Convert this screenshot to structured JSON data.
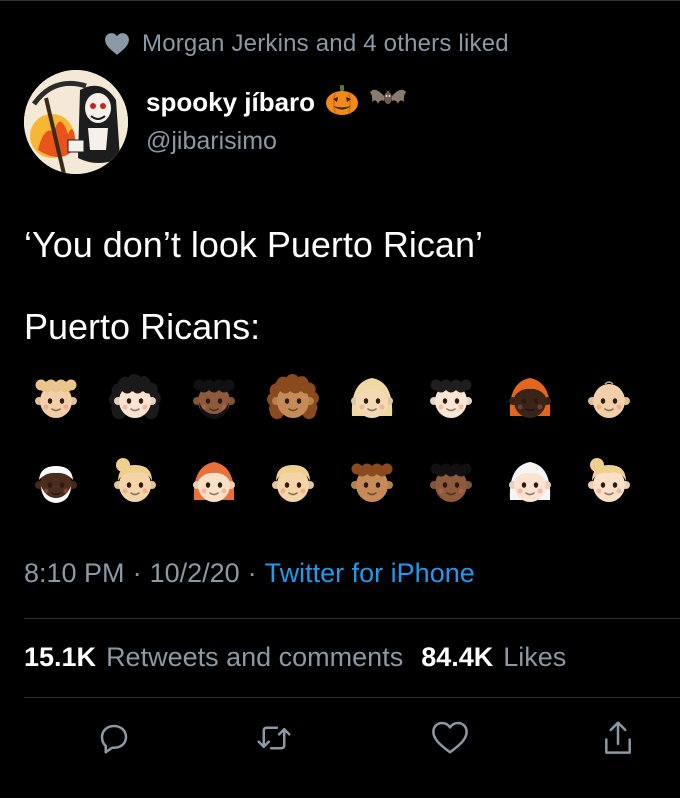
{
  "social_context": {
    "text": "Morgan Jerkins and 4 others liked",
    "icon": "heart-icon"
  },
  "author": {
    "display_name": "spooky jíbaro",
    "handle": "@jibarisimo",
    "name_emojis": [
      "jack-o-lantern-icon",
      "bat-icon"
    ]
  },
  "tweet": {
    "line1": "‘You don’t look Puerto Rican’",
    "line2": "Puerto Ricans:",
    "emojis": [
      {
        "name": "curly-hair-light-face-emoji",
        "skin": "#f2cfa8",
        "hair": "#e8c58a",
        "style": "curly"
      },
      {
        "name": "curly-hair-woman-light-face-emoji",
        "skin": "#fbe3cf",
        "hair": "#1a1a1a",
        "style": "long-curly"
      },
      {
        "name": "curly-hair-man-medium-dark-face-emoji",
        "skin": "#8d5a3b",
        "hair": "#111111",
        "style": "curly-beard"
      },
      {
        "name": "curly-hair-woman-medium-face-emoji",
        "skin": "#c68c57",
        "hair": "#8a4a1e",
        "style": "long-curly"
      },
      {
        "name": "blond-woman-face-emoji",
        "skin": "#f4d9b5",
        "hair": "#f1d7a0",
        "style": "long-straight"
      },
      {
        "name": "curly-hair-light-face-emoji-2",
        "skin": "#fbe6d6",
        "hair": "#1e1e1e",
        "style": "curly"
      },
      {
        "name": "dark-woman-red-hair-emoji",
        "skin": "#3a2418",
        "hair": "#e2661f",
        "style": "long-straight"
      },
      {
        "name": "baby-face-emoji",
        "skin": "#f2cfa8",
        "hair": "#f2cfa8",
        "style": "bald"
      },
      {
        "name": "old-man-dark-face-emoji",
        "skin": "#4a2d1c",
        "hair": "#ffffff",
        "style": "white-hair-beard"
      },
      {
        "name": "blond-ponytail-face-emoji",
        "skin": "#f4d4a8",
        "hair": "#efcf8e",
        "style": "ponytail"
      },
      {
        "name": "red-hair-woman-face-emoji",
        "skin": "#fbe0c8",
        "hair": "#e8703a",
        "style": "long-straight"
      },
      {
        "name": "blond-man-face-emoji",
        "skin": "#f4d4a8",
        "hair": "#efcf8e",
        "style": "short"
      },
      {
        "name": "curly-hair-medium-face-emoji",
        "skin": "#c68c57",
        "hair": "#8a4a1e",
        "style": "curly"
      },
      {
        "name": "curly-hair-medium-dark-face-emoji",
        "skin": "#8d5a3b",
        "hair": "#111111",
        "style": "curly"
      },
      {
        "name": "white-hair-woman-face-emoji",
        "skin": "#fbe3cf",
        "hair": "#f5f5f5",
        "style": "long-straight"
      },
      {
        "name": "blond-ponytail-face-emoji-2",
        "skin": "#fbe0c8",
        "hair": "#efcf8e",
        "style": "ponytail"
      }
    ]
  },
  "meta": {
    "time": "8:10 PM",
    "separator": "·",
    "date": "10/2/20",
    "source": "Twitter for iPhone"
  },
  "stats": {
    "retweets_count": "15.1K",
    "retweets_label": "Retweets and comments",
    "likes_count": "84.4K",
    "likes_label": "Likes"
  },
  "actions": [
    "reply-icon",
    "retweet-icon",
    "like-icon",
    "share-icon"
  ],
  "colors": {
    "background": "#000000",
    "secondary_text": "#8b98a5",
    "link": "#1d9bf0",
    "divider": "#2f3336"
  }
}
